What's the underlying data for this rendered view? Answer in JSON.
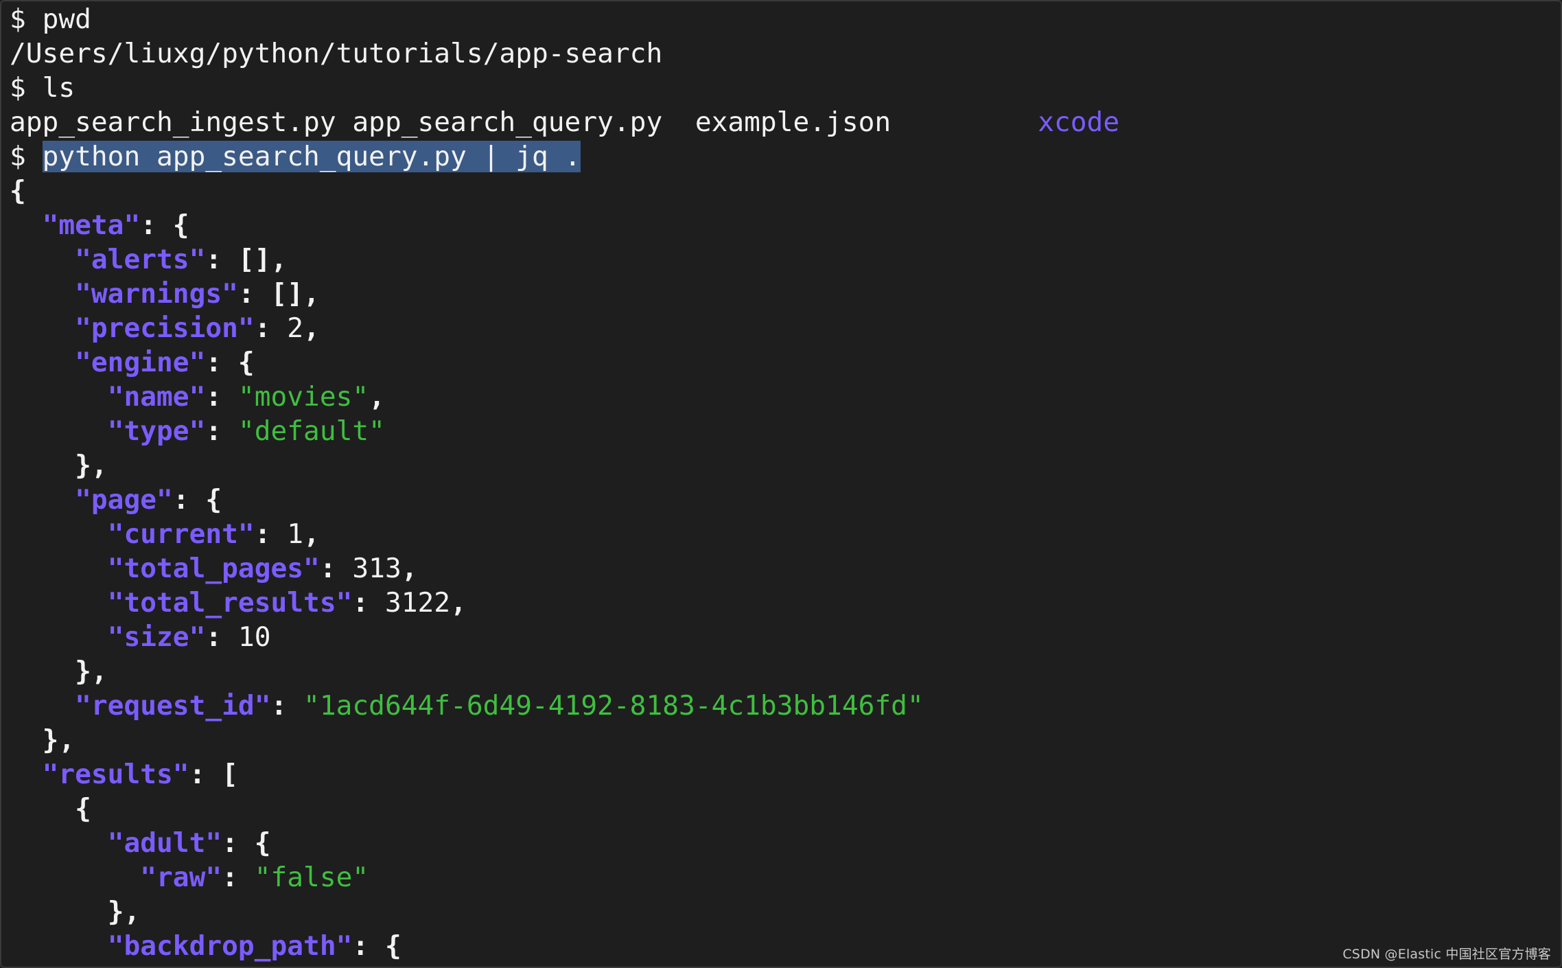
{
  "terminal": {
    "lines": {
      "l0": {
        "prompt": "$ ",
        "cmd": "pwd"
      },
      "l1": {
        "text": "/Users/liuxg/python/tutorials/app-search"
      },
      "l2": {
        "prompt": "$ ",
        "cmd": "ls"
      },
      "l3": {
        "f1": "app_search_ingest.py",
        "f2": "app_search_query.py",
        "f3": "example.json",
        "d1": "xcode"
      },
      "l4": {
        "prompt": "$ ",
        "cmd": "python app_search_query.py | jq ."
      },
      "l5": {
        "p": "{"
      },
      "l6": {
        "k": "\"meta\"",
        "p": ": {"
      },
      "l7": {
        "k": "\"alerts\"",
        "p": ": [],"
      },
      "l8": {
        "k": "\"warnings\"",
        "p": ": [],"
      },
      "l9": {
        "k": "\"precision\"",
        "p": ": ",
        "v": "2",
        "e": ","
      },
      "l10": {
        "k": "\"engine\"",
        "p": ": {"
      },
      "l11": {
        "k": "\"name\"",
        "p": ": ",
        "s": "\"movies\"",
        "e": ","
      },
      "l12": {
        "k": "\"type\"",
        "p": ": ",
        "s": "\"default\""
      },
      "l13": {
        "p": "},"
      },
      "l14": {
        "k": "\"page\"",
        "p": ": {"
      },
      "l15": {
        "k": "\"current\"",
        "p": ": ",
        "v": "1",
        "e": ","
      },
      "l16": {
        "k": "\"total_pages\"",
        "p": ": ",
        "v": "313",
        "e": ","
      },
      "l17": {
        "k": "\"total_results\"",
        "p": ": ",
        "v": "3122",
        "e": ","
      },
      "l18": {
        "k": "\"size\"",
        "p": ": ",
        "v": "10"
      },
      "l19": {
        "p": "},"
      },
      "l20": {
        "k": "\"request_id\"",
        "p": ": ",
        "s": "\"1acd644f-6d49-4192-8183-4c1b3bb146fd\""
      },
      "l21": {
        "p": "},"
      },
      "l22": {
        "k": "\"results\"",
        "p": ": ["
      },
      "l23": {
        "p": "{"
      },
      "l24": {
        "k": "\"adult\"",
        "p": ": {"
      },
      "l25": {
        "k": "\"raw\"",
        "p": ": ",
        "s": "\"false\""
      },
      "l26": {
        "p": "},"
      },
      "l27": {
        "k": "\"backdrop_path\"",
        "p": ": {"
      }
    }
  },
  "watermark": "CSDN @Elastic 中国社区官方博客",
  "colors": {
    "background": "#1e1e1e",
    "foreground": "#f2f2f2",
    "json_key": "#7b5cff",
    "json_string": "#3fbf3f",
    "directory": "#7b5cff",
    "selection": "#3b5a86"
  }
}
